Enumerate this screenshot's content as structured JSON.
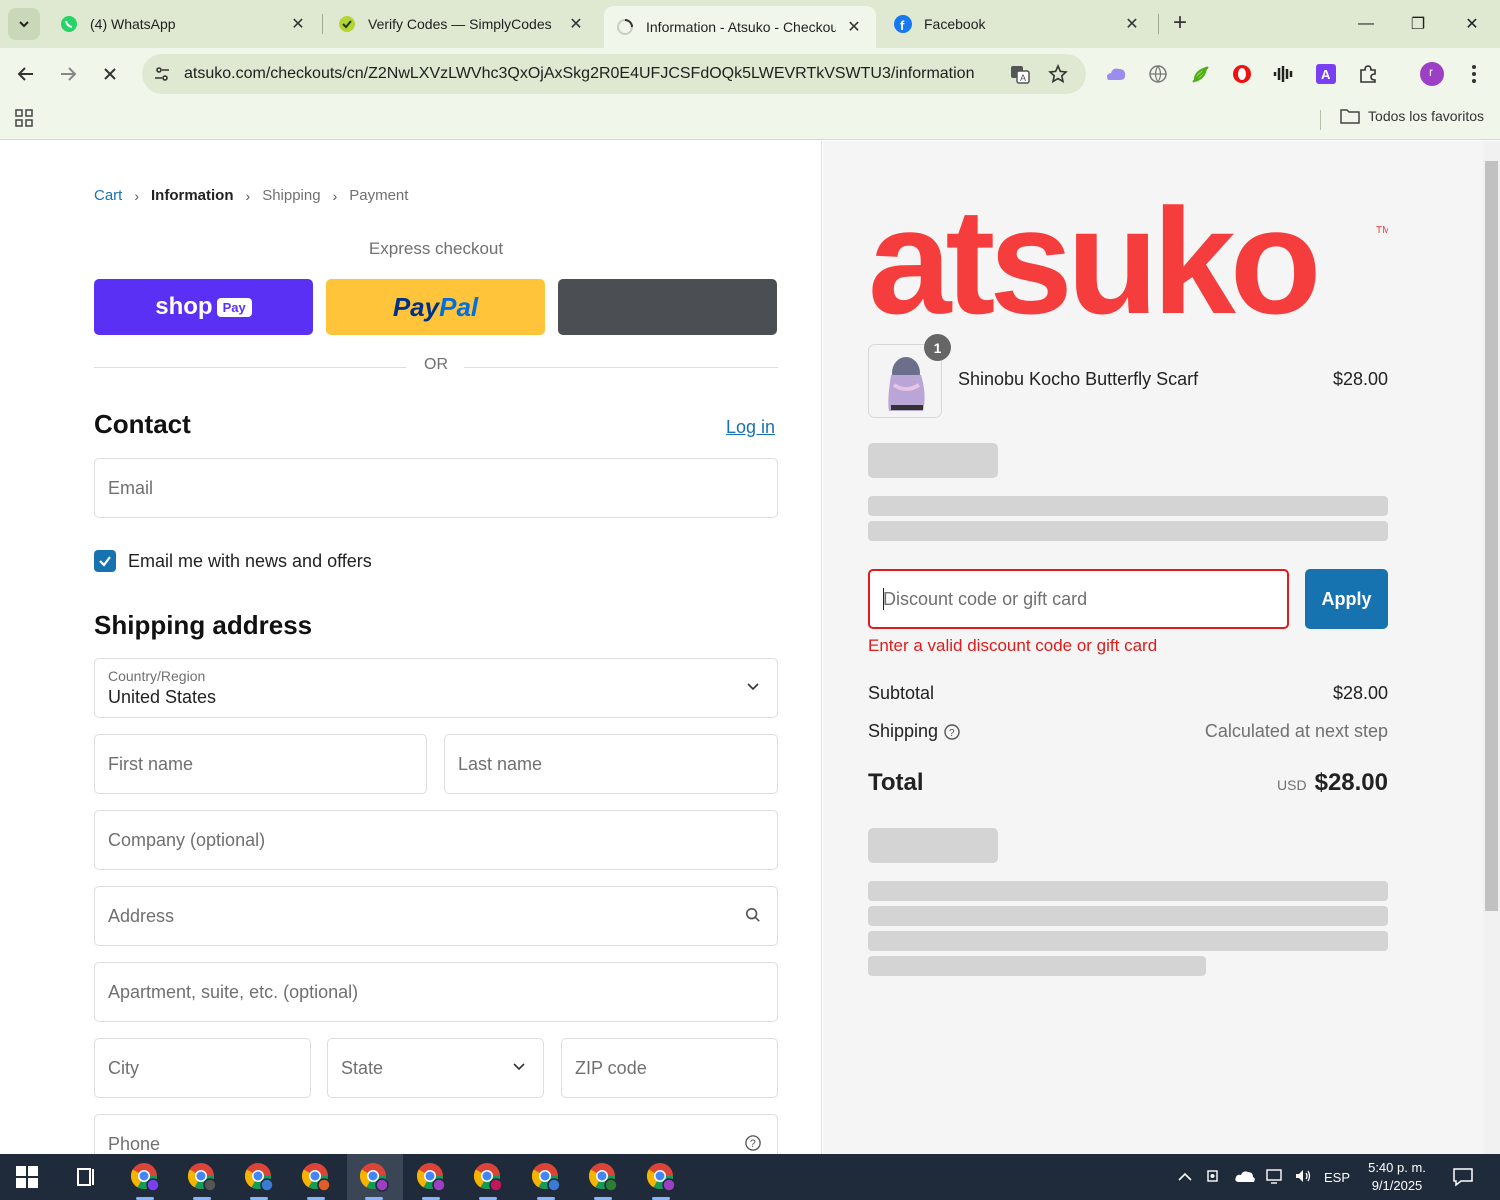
{
  "browser": {
    "tabs": [
      {
        "title": "(4) WhatsApp",
        "icon": "whatsapp-icon"
      },
      {
        "title": "Verify Codes — SimplyCodes",
        "icon": "simplycodes-icon"
      },
      {
        "title": "Information - Atsuko - Checkou",
        "icon": "loading-icon",
        "active": true
      },
      {
        "title": "Facebook",
        "icon": "facebook-icon"
      }
    ],
    "url": "atsuko.com/checkouts/cn/Z2NwLXVzLWVhc3QxOjAxSkg2R0E4UFJCSFdOQk5LWEVRTkVSWTU3/information",
    "bookmarks_folder": "Todos los favoritos",
    "profile_initial": "r",
    "accent": "#dfe9d2"
  },
  "breadcrumb": {
    "cart": "Cart",
    "information": "Information",
    "shipping": "Shipping",
    "payment": "Payment"
  },
  "express": {
    "heading": "Express checkout",
    "shop_label": "shop",
    "shop_pill": "Pay",
    "paypal_a": "Pay",
    "paypal_b": "Pal",
    "or": "OR"
  },
  "contact": {
    "heading": "Contact",
    "login": "Log in",
    "email_placeholder": "Email",
    "newsletter_label": "Email me with news and offers",
    "newsletter_checked": true
  },
  "shipping": {
    "heading": "Shipping address",
    "country_label": "Country/Region",
    "country_value": "United States",
    "first_name": "First name",
    "last_name": "Last name",
    "company": "Company (optional)",
    "address": "Address",
    "apartment": "Apartment, suite, etc. (optional)",
    "city": "City",
    "state": "State",
    "zip": "ZIP code",
    "phone": "Phone"
  },
  "summary": {
    "brand": "atsuko",
    "brand_color": "#f53d3d",
    "item": {
      "name": "Shinobu Kocho Butterfly Scarf",
      "price": "$28.00",
      "quantity": "1"
    },
    "discount_placeholder": "Discount code or gift card",
    "apply": "Apply",
    "error": "Enter a valid discount code or gift card",
    "error_color": "#dd1d1d",
    "subtotal_label": "Subtotal",
    "subtotal_value": "$28.00",
    "shipping_label": "Shipping",
    "shipping_value": "Calculated at next step",
    "total_label": "Total",
    "currency": "USD",
    "total_value": "$28.00"
  },
  "taskbar": {
    "language": "ESP",
    "time": "5:40 p. m.",
    "date": "9/1/2025"
  }
}
